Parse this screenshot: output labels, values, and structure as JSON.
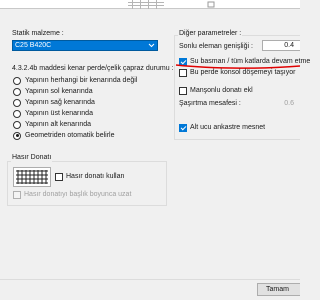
{
  "left": {
    "material_label": "Statik malzeme :",
    "material_value": "C25 B420C",
    "cross_tie_label": "4.3.2.4b maddesi kenar perde/çelik çapraz durumu :",
    "radios": [
      {
        "label": "Yapının herhangi bir kenarında değil",
        "checked": false
      },
      {
        "label": "Yapının sol kenarında",
        "checked": false
      },
      {
        "label": "Yapının sağ kenarında",
        "checked": false
      },
      {
        "label": "Yapının üst kenarında",
        "checked": false
      },
      {
        "label": "Yapının alt kenarında",
        "checked": false
      },
      {
        "label": "Geometriden otomatik belirle",
        "checked": true
      }
    ]
  },
  "mesh": {
    "group_title": "Hasır Donatı",
    "use_label": "Hasır donatı kullan",
    "extend_label": "Hasır donatıyı başlık boyunca uzat"
  },
  "right": {
    "group_title": "Diğer parametreler :",
    "last_element_width_label": "Sonlu eleman genişliği :",
    "last_element_width_value": "0.4",
    "basement_label": "Su basman / tüm katlarda devam etme",
    "basement_checked": true,
    "console_label": "Bu perde konsol döşemeyi taşıyor",
    "console_checked": false,
    "mansonlu_label": "Manşonlu donatı ekl",
    "mansonlu_checked": false,
    "offset_label": "Şaşırtma mesafesi :",
    "offset_value": "0.6",
    "fixed_label": "Alt ucu ankastre mesnet",
    "fixed_checked": true
  },
  "footer": {
    "ok_label": "Tamam"
  },
  "colors": {
    "accent": "#0078d7",
    "annotation_red": "#e00000"
  }
}
